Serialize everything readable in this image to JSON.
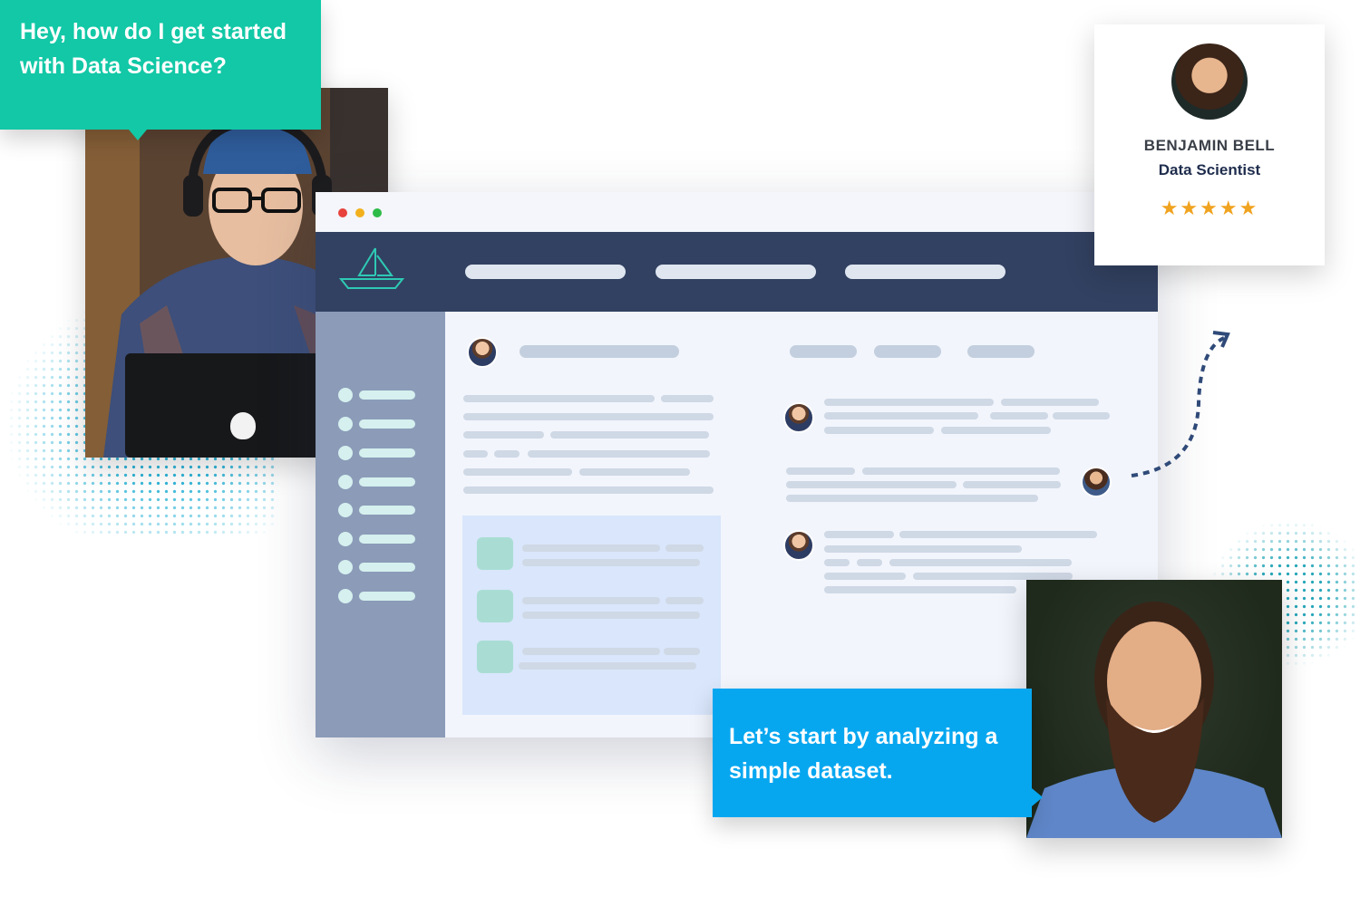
{
  "learner": {
    "question": "Hey, how do I get started with Data Science?"
  },
  "mentor": {
    "name": "BENJAMIN BELL",
    "role": "Data Scientist",
    "rating_stars": 5,
    "stars_text": "★★★★★",
    "reply": "Let’s start by analyzing a simple dataset."
  },
  "browser": {
    "window_controls": [
      "close",
      "minimize",
      "maximize"
    ],
    "logo_icon": "sailboat-icon",
    "sidebar_item_count": 8
  },
  "colors": {
    "question_bubble": "#12c8a6",
    "answer_bubble": "#07a7f0",
    "app_header": "#324161",
    "sidebar": "#8b9bb8",
    "star": "#f0a31f"
  }
}
